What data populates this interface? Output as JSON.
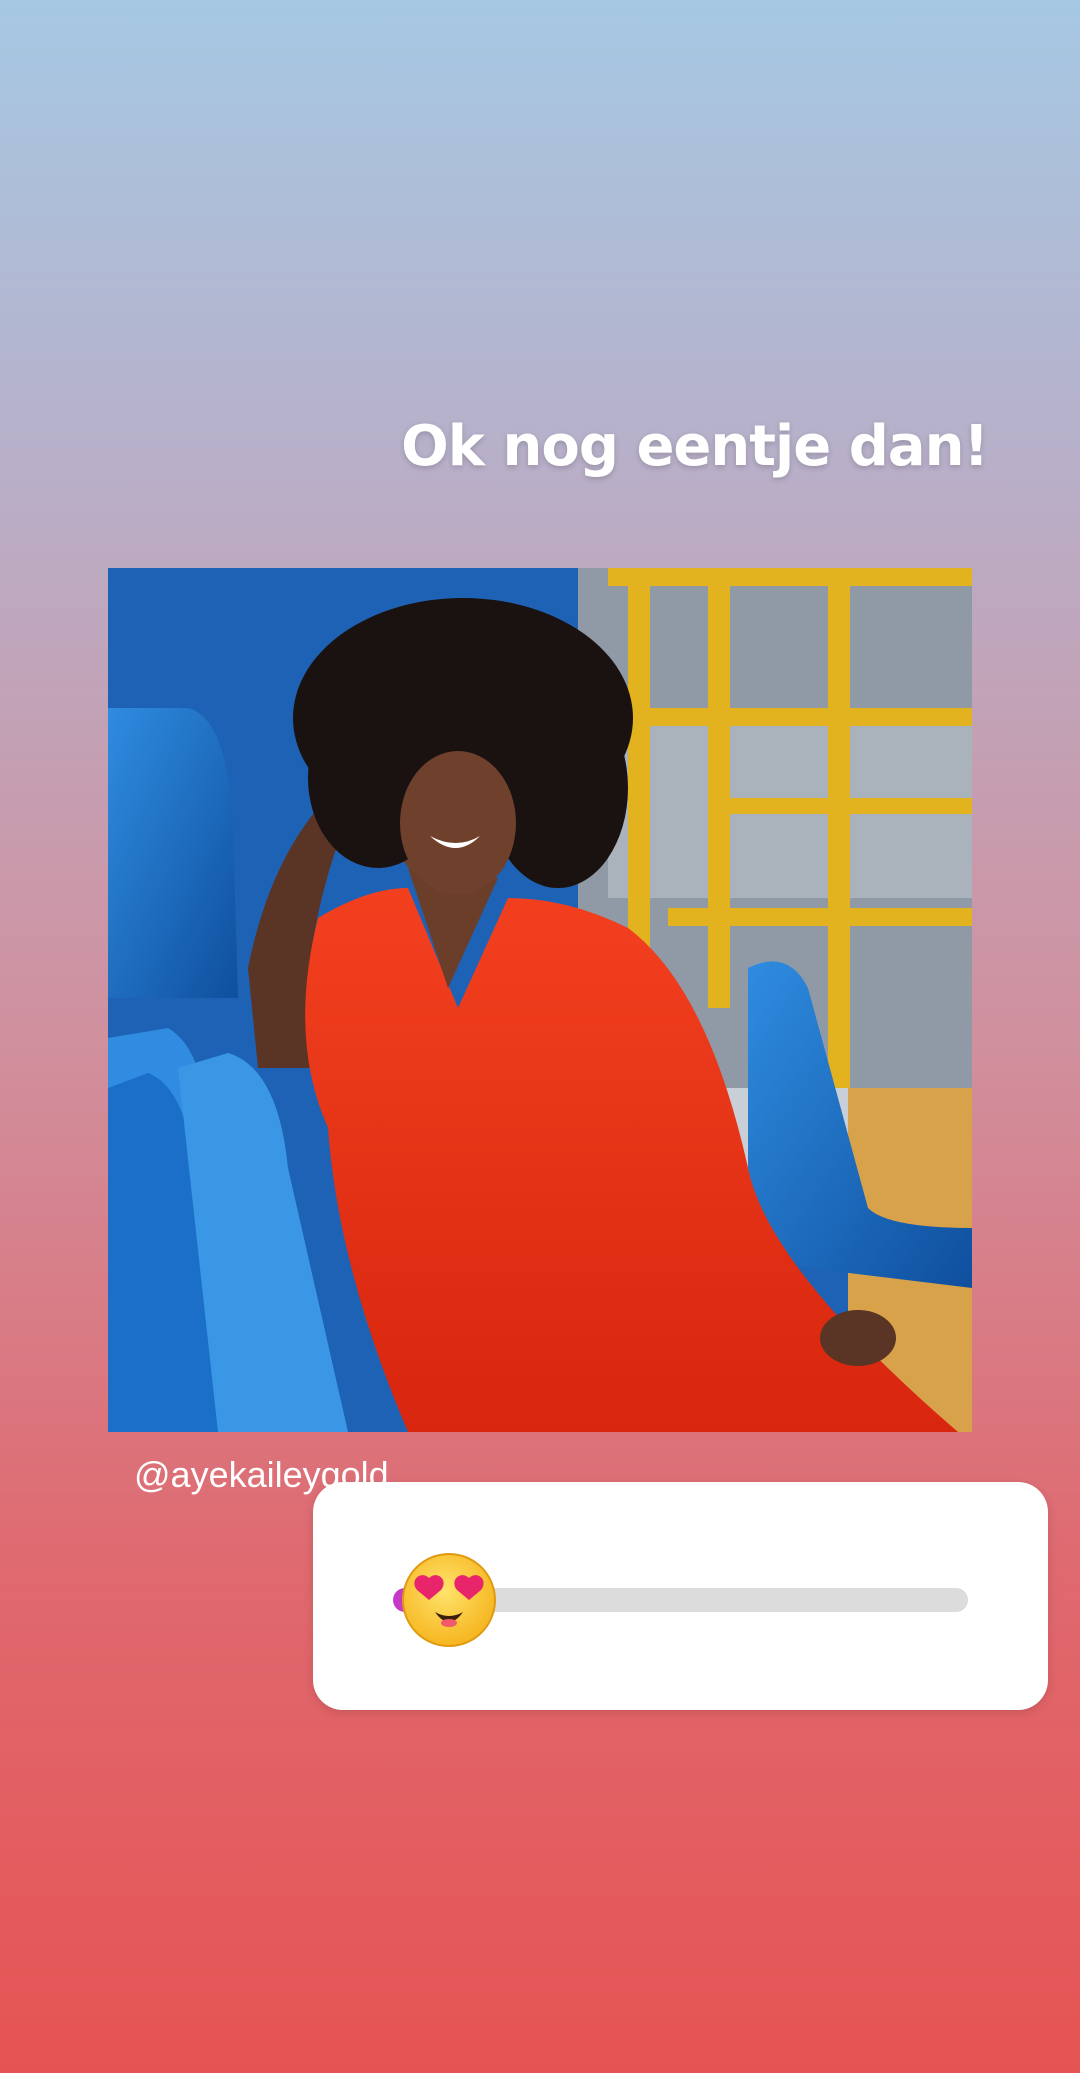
{
  "story": {
    "caption": "Ok nog eentje dan!",
    "photo_credit": "@ayekaileygold"
  },
  "emoji_slider": {
    "emoji": "heart-eyes-face",
    "value": 0.0,
    "track_color": "#dcdcdc",
    "fill_color": "#c43bc6"
  },
  "colors": {
    "gradient_top": "#a6c8e3",
    "gradient_bottom": "#e65353"
  }
}
